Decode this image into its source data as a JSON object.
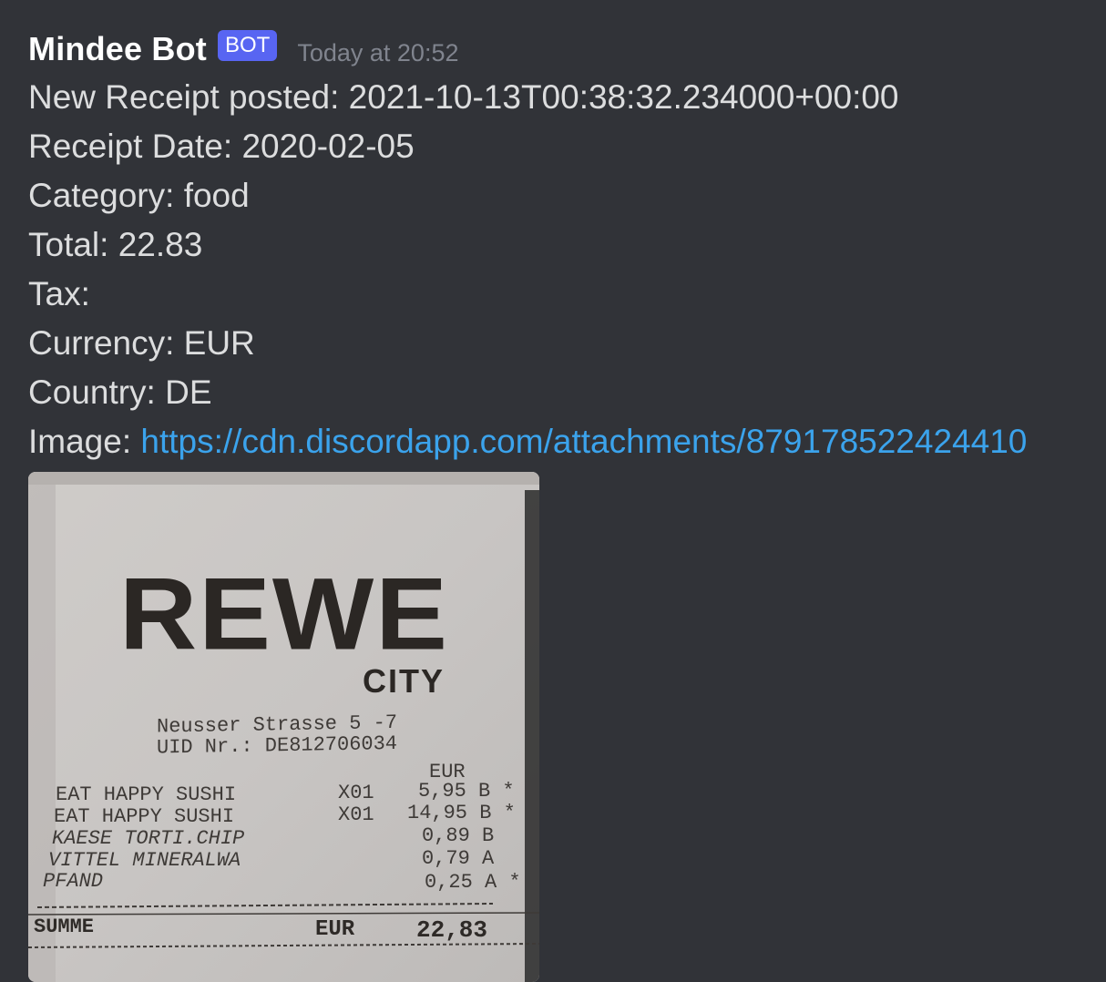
{
  "message": {
    "author": "Mindee Bot",
    "bot_tag": "BOT",
    "timestamp": "Today at 20:52",
    "lines": {
      "posted": "New Receipt posted: 2021-10-13T00:38:32.234000+00:00",
      "date": "Receipt Date: 2020-02-05",
      "category": "Category: food",
      "total": "Total: 22.83",
      "tax": "Tax:",
      "currency": "Currency: EUR",
      "country": "Country: DE",
      "image_label": "Image: ",
      "image_url": "https://cdn.discordapp.com/attachments/879178522424410"
    }
  },
  "receipt": {
    "brand": "REWE",
    "brand_sub": "CITY",
    "address": "Neusser Strasse 5 -7",
    "uid": "UID Nr.: DE812706034",
    "currency_header": "EUR",
    "items": [
      {
        "name": "EAT HAPPY SUSHI",
        "qty": "X01",
        "price": "5,95 B *"
      },
      {
        "name": "EAT HAPPY SUSHI",
        "qty": "X01",
        "price": "14,95 B *"
      },
      {
        "name": "KAESE TORTI.CHIP",
        "qty": "",
        "price": "0,89 B"
      },
      {
        "name": "VITTEL MINERALWA",
        "qty": "",
        "price": "0,79 A"
      },
      {
        "name": "PFAND",
        "qty": "",
        "price": "0,25 A *"
      }
    ],
    "sum_label": "SUMME",
    "sum_currency": "EUR",
    "sum_value": "22,83"
  },
  "colors": {
    "background": "#313338",
    "username": "#ffffff",
    "bot_badge": "#5865f2",
    "timestamp": "#80848e",
    "text": "#dcddde",
    "link": "#3ba3ec"
  }
}
